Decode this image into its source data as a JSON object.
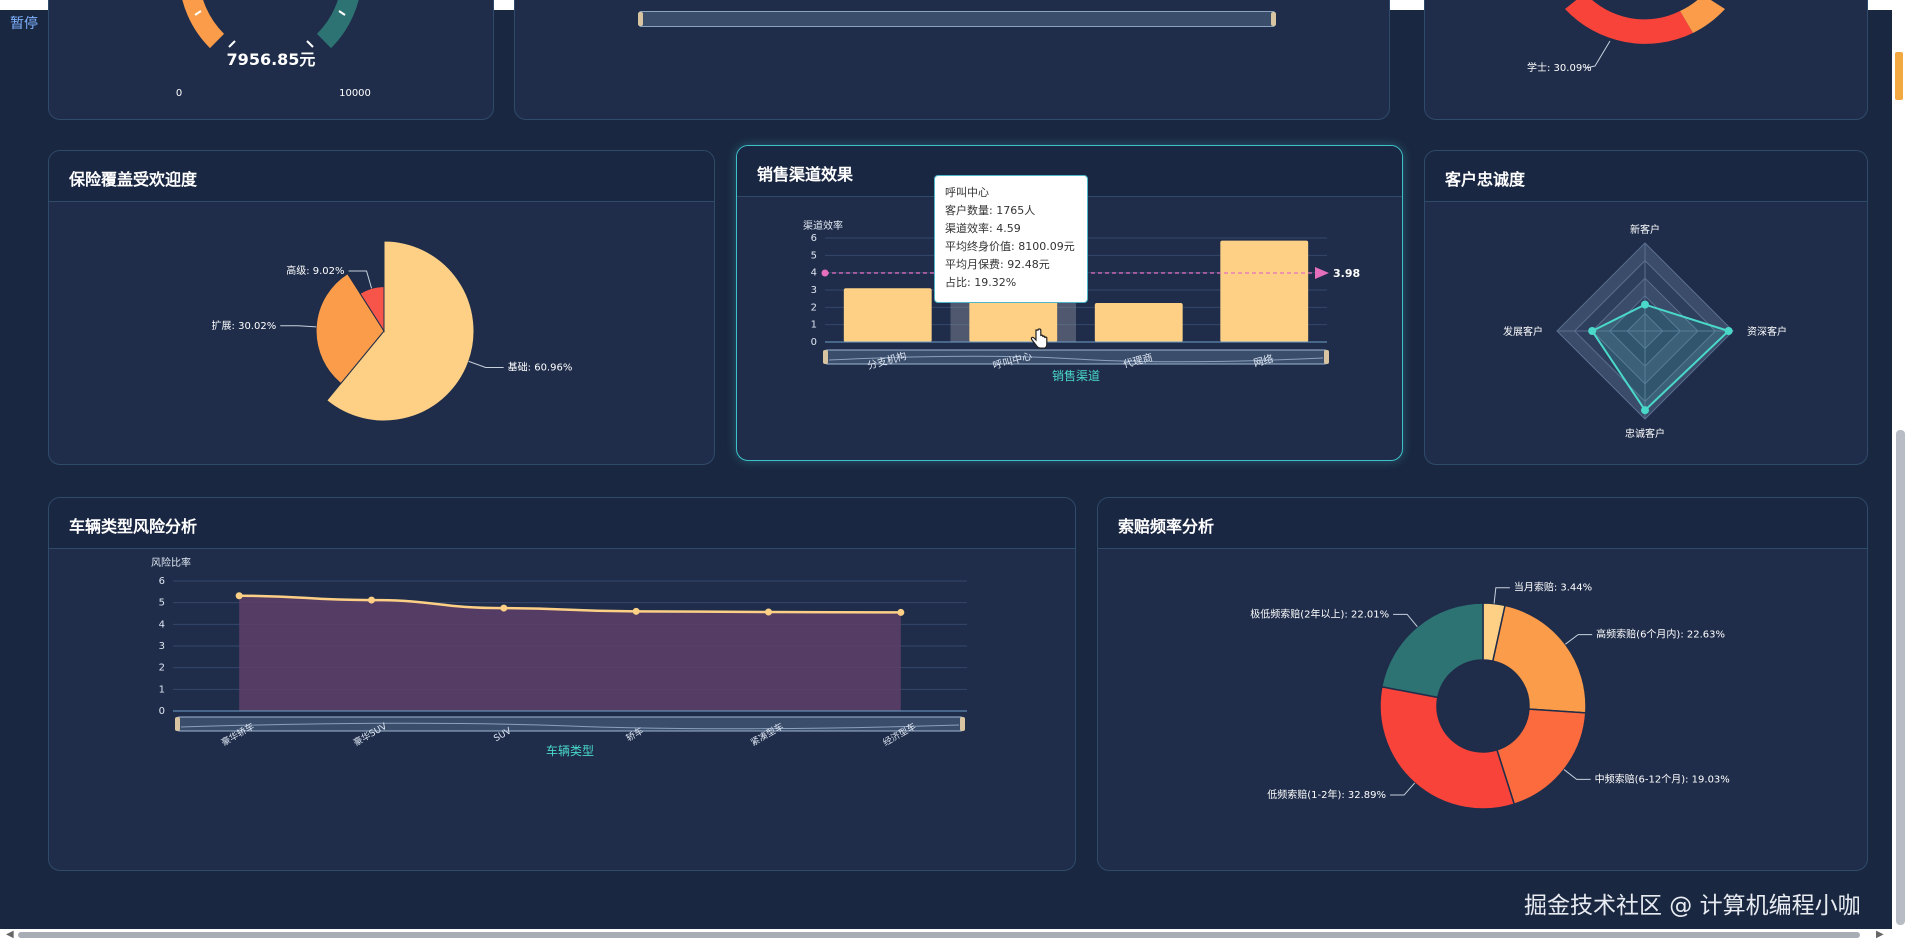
{
  "top_row": {
    "gauge": {
      "value_text": "7956.85元",
      "min": "0",
      "max": "10000",
      "value": 7956.85,
      "range": [
        0,
        10000
      ]
    },
    "pie_label": "学士: 30.09%"
  },
  "overlay": {
    "pause_label": "暂停"
  },
  "coverage_panel": {
    "title": "保险覆盖受欢迎度",
    "chart_data": {
      "type": "pie",
      "subtype": "rose",
      "categories": [
        "基础",
        "扩展",
        "高级"
      ],
      "values": [
        60.96,
        30.02,
        9.02
      ],
      "labels": [
        "基础: 60.96%",
        "扩展: 30.02%",
        "高级: 9.02%"
      ],
      "colors": [
        "#fdd086",
        "#fa9c49",
        "#f7544a"
      ]
    }
  },
  "sales_panel": {
    "title": "销售渠道效果",
    "chart_data": {
      "type": "bar",
      "categories": [
        "分支机构",
        "呼叫中心",
        "代理商",
        "网络"
      ],
      "values": [
        3.1,
        4.59,
        2.25,
        5.85
      ],
      "ylabel": "渠道效率",
      "xlabel": "销售渠道",
      "ylim": [
        0,
        6
      ],
      "yticks": [
        "0",
        "1",
        "2",
        "3",
        "4",
        "5",
        "6"
      ],
      "average_line": {
        "value": 3.98,
        "label": "3.98"
      },
      "highlighted": "呼叫中心",
      "colors": {
        "bar": "#fdd086",
        "average": "#e66fbd",
        "highlight": "#8a8f9c"
      }
    },
    "tooltip": {
      "title": "呼叫中心",
      "lines": [
        "客户数量: 1765人",
        "渠道效率: 4.59",
        "平均终身价值: 8100.09元",
        "平均月保费: 92.48元",
        "占比: 19.32%"
      ]
    }
  },
  "loyalty_panel": {
    "title": "客户忠诚度",
    "chart_data": {
      "type": "radar",
      "indicators": [
        "新客户",
        "资深客户",
        "忠诚客户",
        "发展客户"
      ],
      "values": [
        0.3,
        0.95,
        0.9,
        0.6
      ],
      "colors": {
        "series": "#4ad8c9"
      }
    }
  },
  "vehicle_panel": {
    "title": "车辆类型风险分析",
    "chart_data": {
      "type": "area",
      "categories": [
        "豪华轿车",
        "豪华SUV",
        "SUV",
        "轿车",
        "紧凑型车",
        "经济型车"
      ],
      "values": [
        5.32,
        5.12,
        4.75,
        4.6,
        4.57,
        4.55
      ],
      "ylabel": "风险比率",
      "xlabel": "车辆类型",
      "ylim": [
        0,
        6
      ],
      "yticks": [
        "0",
        "1",
        "2",
        "3",
        "4",
        "5",
        "6"
      ],
      "colors": {
        "line": "#fdd086",
        "fill": "#5e3f68"
      }
    }
  },
  "claims_panel": {
    "title": "索赔频率分析",
    "chart_data": {
      "type": "pie",
      "subtype": "donut",
      "categories": [
        "当月索赔",
        "高频索赔(6个月内)",
        "中频索赔(6-12个月)",
        "低频索赔(1-2年)",
        "极低频索赔(2年以上)"
      ],
      "values": [
        3.44,
        22.63,
        19.03,
        32.89,
        22.01
      ],
      "labels": [
        "当月索赔: 3.44%",
        "高频索赔(6个月内): 22.63%",
        "中频索赔(6-12个月): 19.03%",
        "低频索赔(1-2年): 32.89%",
        "极低频索赔(2年以上): 22.01%"
      ],
      "colors": [
        "#fdd086",
        "#fa9c49",
        "#fb6b3e",
        "#f7433a",
        "#2d7373"
      ]
    }
  },
  "watermark": "掘金技术社区 @ 计算机编程小咖"
}
